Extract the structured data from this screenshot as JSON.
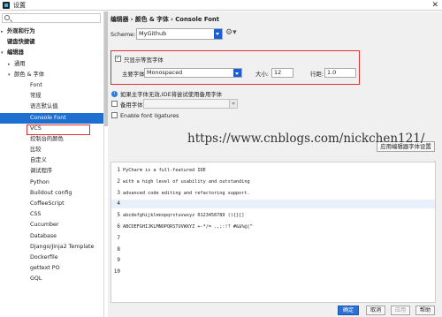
{
  "window": {
    "title": "设置"
  },
  "sidebar": {
    "items": [
      {
        "label": "外观和行为",
        "level": 1,
        "arrow": "▸",
        "bold": true
      },
      {
        "label": "键盘快捷键",
        "level": 1,
        "arrow": "",
        "bold": true
      },
      {
        "label": "编辑器",
        "level": 1,
        "arrow": "▾",
        "bold": true
      },
      {
        "label": "通用",
        "level": 2,
        "arrow": "▸"
      },
      {
        "label": "颜色 & 字体",
        "level": 2,
        "arrow": "▾"
      },
      {
        "label": "Font",
        "level": 3
      },
      {
        "label": "常规",
        "level": 3
      },
      {
        "label": "语言默认值",
        "level": 3
      },
      {
        "label": "Console Font",
        "level": 3,
        "selected": true
      },
      {
        "label": "VCS",
        "level": 3
      },
      {
        "label": "控制台的颜色",
        "level": 3
      },
      {
        "label": "比较",
        "level": 3
      },
      {
        "label": "自定义",
        "level": 3
      },
      {
        "label": "调试程序",
        "level": 3
      },
      {
        "label": "Python",
        "level": 3
      },
      {
        "label": "Buildout config",
        "level": 3
      },
      {
        "label": "CoffeeScript",
        "level": 3
      },
      {
        "label": "CSS",
        "level": 3
      },
      {
        "label": "Cucumber",
        "level": 3
      },
      {
        "label": "Database",
        "level": 3
      },
      {
        "label": "Django/Jinja2 Template",
        "level": 3
      },
      {
        "label": "Dockerfile",
        "level": 3
      },
      {
        "label": "gettext PO",
        "level": 3
      },
      {
        "label": "GQL",
        "level": 3
      }
    ]
  },
  "main": {
    "breadcrumb": "编辑器 › 颜色 & 字体 › Console Font",
    "scheme_label": "Scheme:",
    "scheme_value": "MyGithub",
    "only_mono_label": "只显示等宽字体",
    "primary_font_label": "主要字体:",
    "primary_font_value": "Monospaced",
    "size_label": "大小:",
    "size_value": "12",
    "line_spacing_label": "行距:",
    "line_spacing_value": "1.0",
    "fallback_info": "如果主字体无效,IDE将尝试使用备用字体",
    "fallback_font_label": "备用字体:",
    "ligatures_label": "Enable font ligatures",
    "apply_editor_font_button": "应用编辑器字体设置"
  },
  "preview": {
    "lines": [
      {
        "num": "1",
        "text": "PyCharm is a full-featured IDE"
      },
      {
        "num": "2",
        "text": "with a high level of usability and outstanding"
      },
      {
        "num": "3",
        "text": "advanced code editing and refactoring support."
      },
      {
        "num": "4",
        "text": ""
      },
      {
        "num": "5",
        "text": "abcdefghijklmnopqrstuvwxyz 0123456789 (){}[]"
      },
      {
        "num": "6",
        "text": "ABCDEFGHIJKLMNOPQRSTUVWXYZ +-*/= .,;:!? #&$%@|^"
      },
      {
        "num": "7",
        "text": ""
      },
      {
        "num": "8",
        "text": ""
      },
      {
        "num": "9",
        "text": ""
      },
      {
        "num": "10",
        "text": ""
      }
    ]
  },
  "watermark": "https://www.cnblogs.com/nickchen121/",
  "buttons": {
    "ok": "确定",
    "cancel": "取消",
    "apply": "应用",
    "help": "帮助"
  },
  "colors": {
    "accent": "#1e6fd0",
    "highlight_red": "#e0302f"
  }
}
